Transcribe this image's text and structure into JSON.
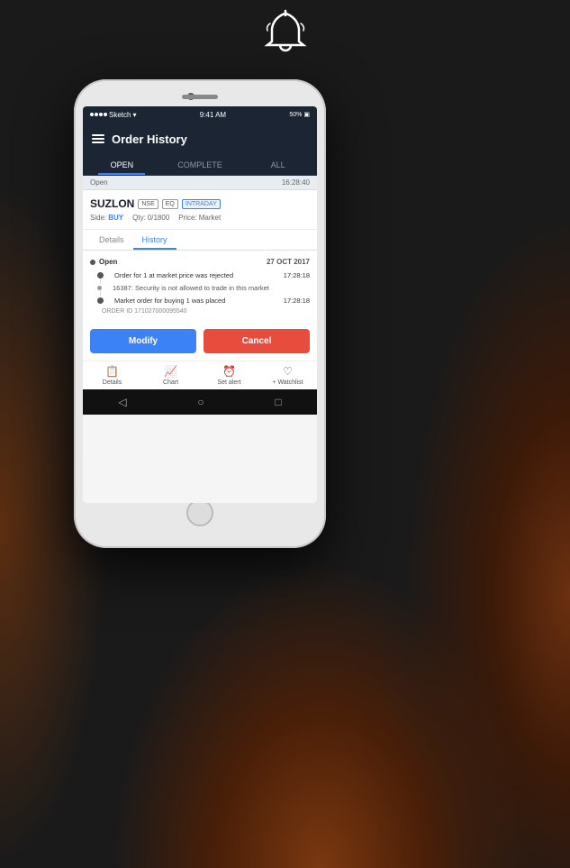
{
  "background": "#1a1a1a",
  "bell": {
    "symbol": "🔔"
  },
  "phone": {
    "status_bar": {
      "carrier": "Sketch",
      "time": "9:41 AM",
      "battery": "50%",
      "signal_dots": 4
    },
    "header": {
      "title": "Order History",
      "menu_icon": "hamburger"
    },
    "tabs": [
      {
        "label": "OPEN",
        "active": true
      },
      {
        "label": "COMPLETE",
        "active": false
      },
      {
        "label": "ALL",
        "active": false
      }
    ],
    "open_row": {
      "label": "Open",
      "time": "16:28:40"
    },
    "order_card": {
      "stock": "SUZLON",
      "exchange": "NSE",
      "segment": "EQ",
      "type": "INTRADAY",
      "side_label": "Side:",
      "side_value": "BUY",
      "qty_label": "Qty:",
      "qty_value": "0/1800",
      "price_label": "Price:",
      "price_value": "Market"
    },
    "inner_tabs": [
      {
        "label": "Details",
        "active": false
      },
      {
        "label": "History",
        "active": true
      }
    ],
    "history": {
      "open_label": "Open",
      "date": "27 OCT 2017",
      "events": [
        {
          "text": "Order for 1 at market price was rejected",
          "time": "17:28:18",
          "sub": ""
        },
        {
          "text": "16387: Security is not allowed to trade in this market",
          "time": "",
          "sub": ""
        },
        {
          "text": "Market order for buying 1 was placed",
          "time": "17:28:18",
          "sub": ""
        }
      ],
      "order_id": "ORDER ID 171027000095540"
    },
    "buttons": {
      "modify": "Modify",
      "cancel": "Cancel"
    },
    "bottom_nav": [
      {
        "icon": "📋",
        "label": "Details"
      },
      {
        "icon": "📈",
        "label": "Chart"
      },
      {
        "icon": "⏰",
        "label": "Set alert"
      },
      {
        "icon": "♡",
        "label": "+ Watchlist"
      }
    ],
    "android_nav": {
      "back": "◁",
      "home": "○",
      "recent": "□"
    }
  }
}
